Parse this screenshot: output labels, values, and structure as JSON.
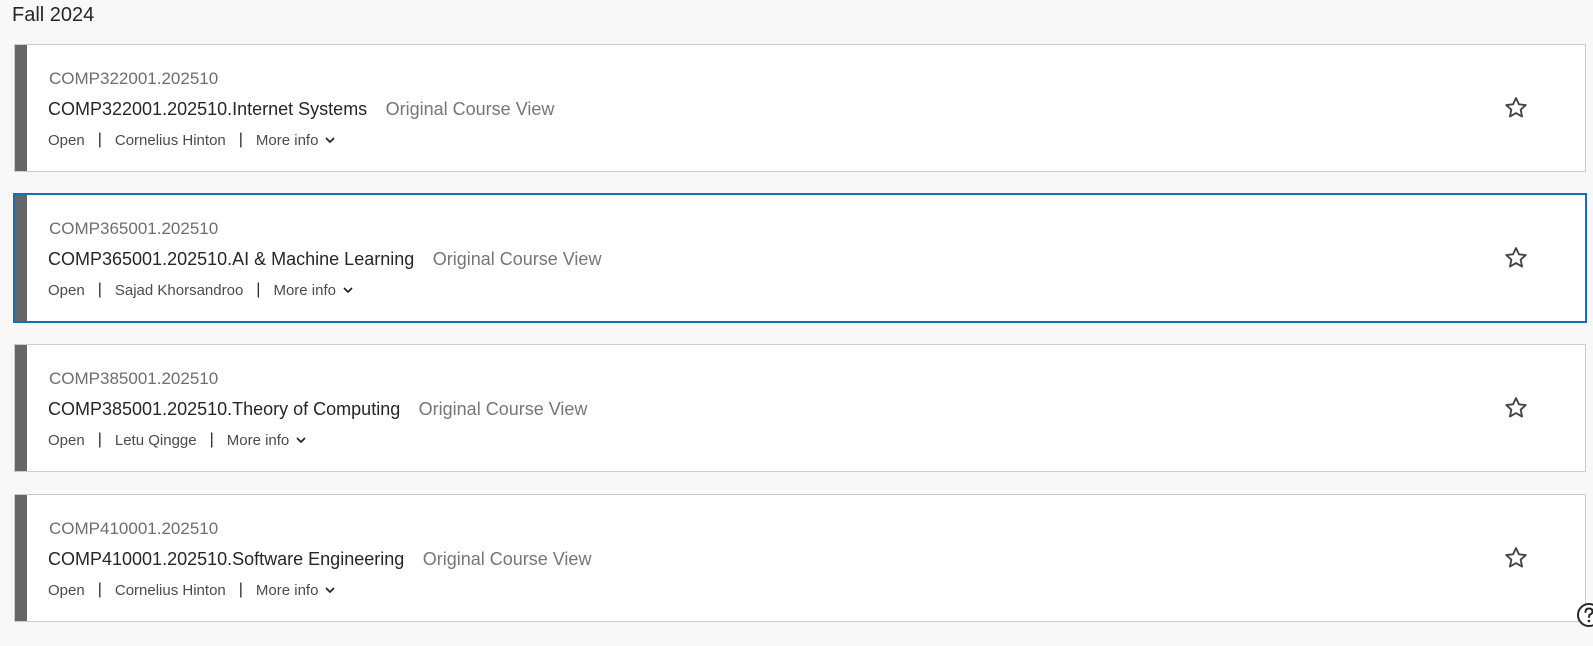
{
  "term": {
    "heading": "Fall 2024"
  },
  "courses": [
    {
      "id": "COMP322001.202510",
      "title": "COMP322001.202510.Internet Systems",
      "view": "Original Course View",
      "status": "Open",
      "instructor": "Cornelius Hinton",
      "more_info": "More info",
      "focused": false
    },
    {
      "id": "COMP365001.202510",
      "title": "COMP365001.202510.AI & Machine Learning",
      "view": "Original Course View",
      "status": "Open",
      "instructor": "Sajad Khorsandroo",
      "more_info": "More info",
      "focused": true
    },
    {
      "id": "COMP385001.202510",
      "title": "COMP385001.202510.Theory of Computing",
      "view": "Original Course View",
      "status": "Open",
      "instructor": "Letu Qingge",
      "more_info": "More info",
      "focused": false
    },
    {
      "id": "COMP410001.202510",
      "title": "COMP410001.202510.Software Engineering",
      "view": "Original Course View",
      "status": "Open",
      "instructor": "Cornelius Hinton",
      "more_info": "More info",
      "focused": false
    }
  ],
  "separator": "|",
  "icons": {
    "favorite": "star-outline-icon",
    "expand": "chevron-down-icon",
    "help": "help-icon"
  },
  "colors": {
    "accent_bar": "#666666",
    "focus_border": "#1b6fa8",
    "view_label": "#767676"
  }
}
